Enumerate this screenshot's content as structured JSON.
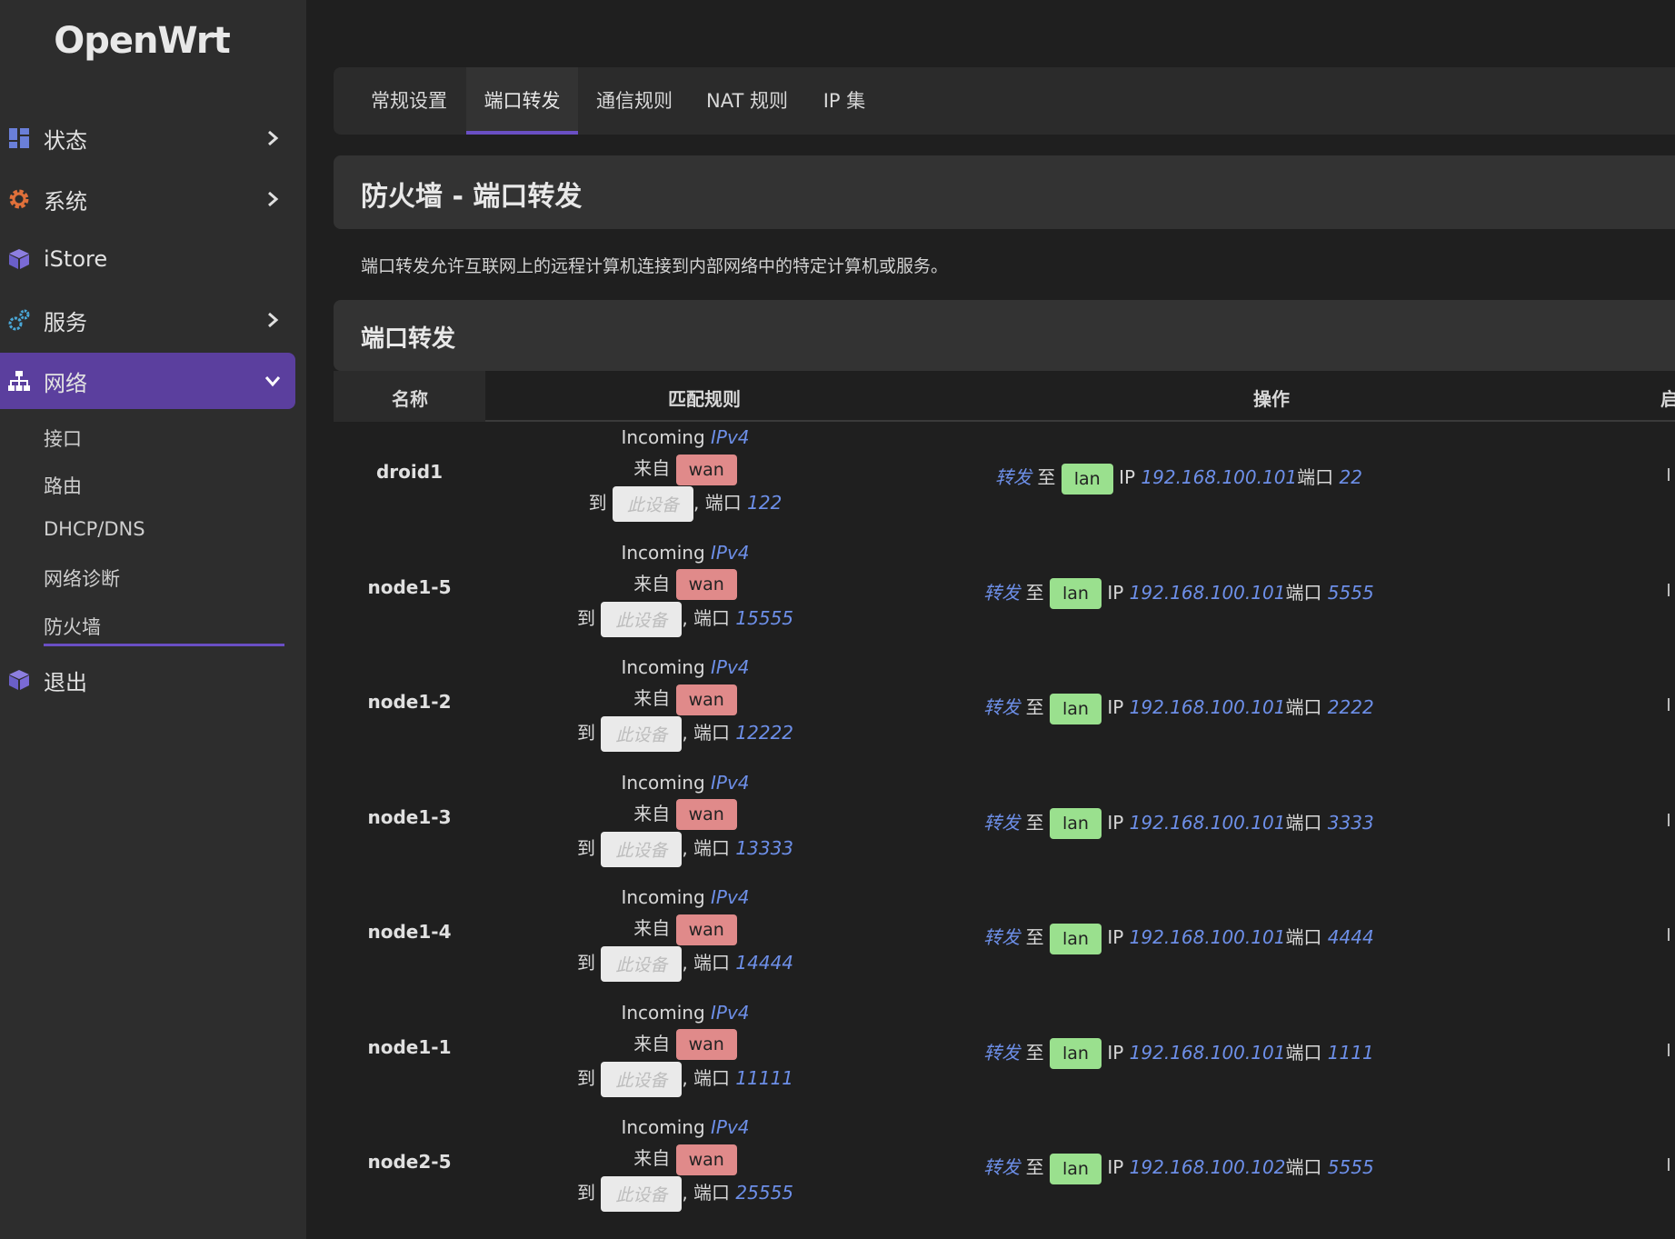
{
  "sidebar": {
    "logo": "OpenWrt",
    "items": [
      {
        "label": "状态",
        "icon": "dashboard-icon"
      },
      {
        "label": "系统",
        "icon": "gear-icon"
      },
      {
        "label": "iStore",
        "icon": "cube-icon"
      },
      {
        "label": "服务",
        "icon": "gears-icon"
      },
      {
        "label": "网络",
        "icon": "sitemap-icon"
      },
      {
        "label": "退出",
        "icon": "cube-icon"
      }
    ],
    "sub_items": [
      "接口",
      "路由",
      "DHCP/DNS",
      "网络诊断",
      "防火墙"
    ]
  },
  "tabs": [
    "常规设置",
    "端口转发",
    "通信规则",
    "NAT 规则",
    "IP 集"
  ],
  "active_tab": "端口转发",
  "page": {
    "title": "防火墙 - 端口转发",
    "description": "端口转发允许互联网上的远程计算机连接到内部网络中的特定计算机或服务。",
    "section_title": "端口转发"
  },
  "table": {
    "headers": {
      "name": "名称",
      "match": "匹配规则",
      "action": "操作",
      "enable": "启"
    },
    "labels": {
      "incoming": "Incoming",
      "from": "来自",
      "to": "到",
      "port": ", 端口",
      "forward": "转发",
      "to_zone": "至",
      "ip": "IP",
      "port2": "端口"
    },
    "rows": [
      {
        "name": "droid1",
        "family": "IPv4",
        "src_zone": "wan",
        "dest_device": "此设备",
        "ext_port": "122",
        "forward": "转发",
        "dest_zone": "lan",
        "ip": "192.168.100.101",
        "int_port": "22"
      },
      {
        "name": "node1-5",
        "family": "IPv4",
        "src_zone": "wan",
        "dest_device": "此设备",
        "ext_port": "15555",
        "forward": "转发",
        "dest_zone": "lan",
        "ip": "192.168.100.101",
        "int_port": "5555"
      },
      {
        "name": "node1-2",
        "family": "IPv4",
        "src_zone": "wan",
        "dest_device": "此设备",
        "ext_port": "12222",
        "forward": "转发",
        "dest_zone": "lan",
        "ip": "192.168.100.101",
        "int_port": "2222"
      },
      {
        "name": "node1-3",
        "family": "IPv4",
        "src_zone": "wan",
        "dest_device": "此设备",
        "ext_port": "13333",
        "forward": "转发",
        "dest_zone": "lan",
        "ip": "192.168.100.101",
        "int_port": "3333"
      },
      {
        "name": "node1-4",
        "family": "IPv4",
        "src_zone": "wan",
        "dest_device": "此设备",
        "ext_port": "14444",
        "forward": "转发",
        "dest_zone": "lan",
        "ip": "192.168.100.101",
        "int_port": "4444"
      },
      {
        "name": "node1-1",
        "family": "IPv4",
        "src_zone": "wan",
        "dest_device": "此设备",
        "ext_port": "11111",
        "forward": "转发",
        "dest_zone": "lan",
        "ip": "192.168.100.101",
        "int_port": "1111"
      },
      {
        "name": "node2-5",
        "family": "IPv4",
        "src_zone": "wan",
        "dest_device": "此设备",
        "ext_port": "25555",
        "forward": "转发",
        "dest_zone": "lan",
        "ip": "192.168.100.102",
        "int_port": "5555"
      }
    ]
  },
  "colors": {
    "accent": "#5b3f9e",
    "wan_badge": "#e08a8a",
    "lan_badge": "#9ae08e",
    "link": "#6d8fe8"
  }
}
